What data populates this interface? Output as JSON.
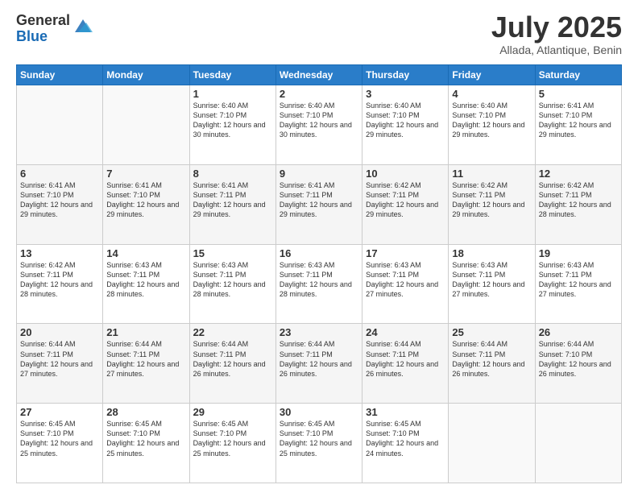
{
  "header": {
    "logo_general": "General",
    "logo_blue": "Blue",
    "month_title": "July 2025",
    "subtitle": "Allada, Atlantique, Benin"
  },
  "days_of_week": [
    "Sunday",
    "Monday",
    "Tuesday",
    "Wednesday",
    "Thursday",
    "Friday",
    "Saturday"
  ],
  "weeks": [
    [
      {
        "day": "",
        "sunrise": "",
        "sunset": "",
        "daylight": ""
      },
      {
        "day": "",
        "sunrise": "",
        "sunset": "",
        "daylight": ""
      },
      {
        "day": "1",
        "sunrise": "Sunrise: 6:40 AM",
        "sunset": "Sunset: 7:10 PM",
        "daylight": "Daylight: 12 hours and 30 minutes."
      },
      {
        "day": "2",
        "sunrise": "Sunrise: 6:40 AM",
        "sunset": "Sunset: 7:10 PM",
        "daylight": "Daylight: 12 hours and 30 minutes."
      },
      {
        "day": "3",
        "sunrise": "Sunrise: 6:40 AM",
        "sunset": "Sunset: 7:10 PM",
        "daylight": "Daylight: 12 hours and 29 minutes."
      },
      {
        "day": "4",
        "sunrise": "Sunrise: 6:40 AM",
        "sunset": "Sunset: 7:10 PM",
        "daylight": "Daylight: 12 hours and 29 minutes."
      },
      {
        "day": "5",
        "sunrise": "Sunrise: 6:41 AM",
        "sunset": "Sunset: 7:10 PM",
        "daylight": "Daylight: 12 hours and 29 minutes."
      }
    ],
    [
      {
        "day": "6",
        "sunrise": "Sunrise: 6:41 AM",
        "sunset": "Sunset: 7:10 PM",
        "daylight": "Daylight: 12 hours and 29 minutes."
      },
      {
        "day": "7",
        "sunrise": "Sunrise: 6:41 AM",
        "sunset": "Sunset: 7:10 PM",
        "daylight": "Daylight: 12 hours and 29 minutes."
      },
      {
        "day": "8",
        "sunrise": "Sunrise: 6:41 AM",
        "sunset": "Sunset: 7:11 PM",
        "daylight": "Daylight: 12 hours and 29 minutes."
      },
      {
        "day": "9",
        "sunrise": "Sunrise: 6:41 AM",
        "sunset": "Sunset: 7:11 PM",
        "daylight": "Daylight: 12 hours and 29 minutes."
      },
      {
        "day": "10",
        "sunrise": "Sunrise: 6:42 AM",
        "sunset": "Sunset: 7:11 PM",
        "daylight": "Daylight: 12 hours and 29 minutes."
      },
      {
        "day": "11",
        "sunrise": "Sunrise: 6:42 AM",
        "sunset": "Sunset: 7:11 PM",
        "daylight": "Daylight: 12 hours and 29 minutes."
      },
      {
        "day": "12",
        "sunrise": "Sunrise: 6:42 AM",
        "sunset": "Sunset: 7:11 PM",
        "daylight": "Daylight: 12 hours and 28 minutes."
      }
    ],
    [
      {
        "day": "13",
        "sunrise": "Sunrise: 6:42 AM",
        "sunset": "Sunset: 7:11 PM",
        "daylight": "Daylight: 12 hours and 28 minutes."
      },
      {
        "day": "14",
        "sunrise": "Sunrise: 6:43 AM",
        "sunset": "Sunset: 7:11 PM",
        "daylight": "Daylight: 12 hours and 28 minutes."
      },
      {
        "day": "15",
        "sunrise": "Sunrise: 6:43 AM",
        "sunset": "Sunset: 7:11 PM",
        "daylight": "Daylight: 12 hours and 28 minutes."
      },
      {
        "day": "16",
        "sunrise": "Sunrise: 6:43 AM",
        "sunset": "Sunset: 7:11 PM",
        "daylight": "Daylight: 12 hours and 28 minutes."
      },
      {
        "day": "17",
        "sunrise": "Sunrise: 6:43 AM",
        "sunset": "Sunset: 7:11 PM",
        "daylight": "Daylight: 12 hours and 27 minutes."
      },
      {
        "day": "18",
        "sunrise": "Sunrise: 6:43 AM",
        "sunset": "Sunset: 7:11 PM",
        "daylight": "Daylight: 12 hours and 27 minutes."
      },
      {
        "day": "19",
        "sunrise": "Sunrise: 6:43 AM",
        "sunset": "Sunset: 7:11 PM",
        "daylight": "Daylight: 12 hours and 27 minutes."
      }
    ],
    [
      {
        "day": "20",
        "sunrise": "Sunrise: 6:44 AM",
        "sunset": "Sunset: 7:11 PM",
        "daylight": "Daylight: 12 hours and 27 minutes."
      },
      {
        "day": "21",
        "sunrise": "Sunrise: 6:44 AM",
        "sunset": "Sunset: 7:11 PM",
        "daylight": "Daylight: 12 hours and 27 minutes."
      },
      {
        "day": "22",
        "sunrise": "Sunrise: 6:44 AM",
        "sunset": "Sunset: 7:11 PM",
        "daylight": "Daylight: 12 hours and 26 minutes."
      },
      {
        "day": "23",
        "sunrise": "Sunrise: 6:44 AM",
        "sunset": "Sunset: 7:11 PM",
        "daylight": "Daylight: 12 hours and 26 minutes."
      },
      {
        "day": "24",
        "sunrise": "Sunrise: 6:44 AM",
        "sunset": "Sunset: 7:11 PM",
        "daylight": "Daylight: 12 hours and 26 minutes."
      },
      {
        "day": "25",
        "sunrise": "Sunrise: 6:44 AM",
        "sunset": "Sunset: 7:11 PM",
        "daylight": "Daylight: 12 hours and 26 minutes."
      },
      {
        "day": "26",
        "sunrise": "Sunrise: 6:44 AM",
        "sunset": "Sunset: 7:10 PM",
        "daylight": "Daylight: 12 hours and 26 minutes."
      }
    ],
    [
      {
        "day": "27",
        "sunrise": "Sunrise: 6:45 AM",
        "sunset": "Sunset: 7:10 PM",
        "daylight": "Daylight: 12 hours and 25 minutes."
      },
      {
        "day": "28",
        "sunrise": "Sunrise: 6:45 AM",
        "sunset": "Sunset: 7:10 PM",
        "daylight": "Daylight: 12 hours and 25 minutes."
      },
      {
        "day": "29",
        "sunrise": "Sunrise: 6:45 AM",
        "sunset": "Sunset: 7:10 PM",
        "daylight": "Daylight: 12 hours and 25 minutes."
      },
      {
        "day": "30",
        "sunrise": "Sunrise: 6:45 AM",
        "sunset": "Sunset: 7:10 PM",
        "daylight": "Daylight: 12 hours and 25 minutes."
      },
      {
        "day": "31",
        "sunrise": "Sunrise: 6:45 AM",
        "sunset": "Sunset: 7:10 PM",
        "daylight": "Daylight: 12 hours and 24 minutes."
      },
      {
        "day": "",
        "sunrise": "",
        "sunset": "",
        "daylight": ""
      },
      {
        "day": "",
        "sunrise": "",
        "sunset": "",
        "daylight": ""
      }
    ]
  ]
}
